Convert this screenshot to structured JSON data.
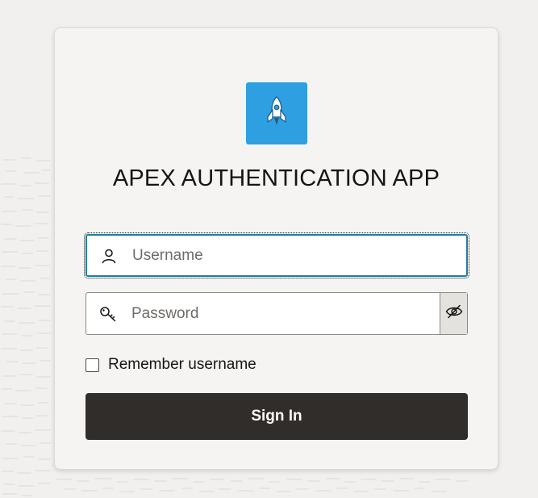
{
  "app": {
    "title": "APEX AUTHENTICATION APP",
    "logo_icon": "rocket-icon",
    "brand_color": "#2e9fe0"
  },
  "login": {
    "username": {
      "icon": "user-icon",
      "placeholder": "Username",
      "value": ""
    },
    "password": {
      "icon": "key-icon",
      "placeholder": "Password",
      "value": "",
      "reveal_icon": "eye-slash-icon"
    },
    "remember": {
      "label": "Remember username",
      "checked": false
    },
    "submit_label": "Sign In",
    "submit_color": "#312d2a",
    "focus_color": "#227e9e"
  }
}
